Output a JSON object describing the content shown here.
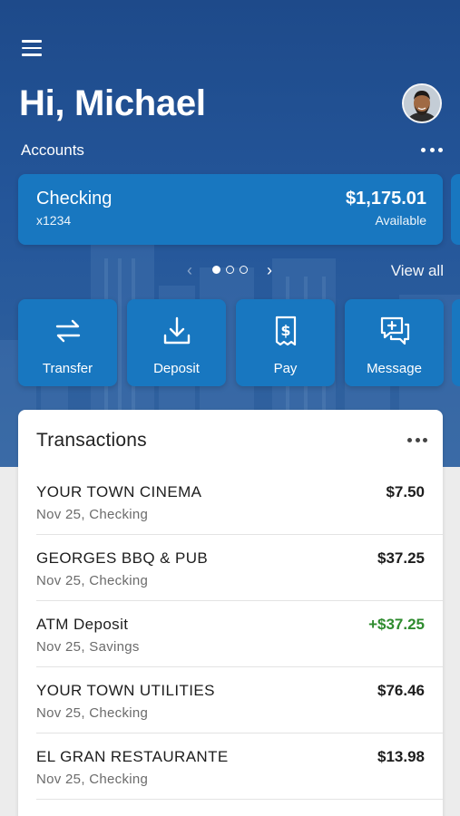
{
  "header": {
    "greeting": "Hi, Michael",
    "menu_icon": "hamburger-menu-icon",
    "avatar_icon": "user-avatar"
  },
  "accounts": {
    "label": "Accounts",
    "more_icon": "more-horizontal-icon",
    "card": {
      "name": "Checking",
      "number": "x1234",
      "balance": "$1,175.01",
      "balance_label": "Available"
    },
    "pager": {
      "total_pages": 3,
      "current_page": 1
    },
    "view_all": "View all"
  },
  "actions": [
    {
      "label": "Transfer",
      "icon": "transfer-arrows-icon"
    },
    {
      "label": "Deposit",
      "icon": "deposit-download-icon"
    },
    {
      "label": "Pay",
      "icon": "pay-bill-icon"
    },
    {
      "label": "Message",
      "icon": "message-add-icon"
    }
  ],
  "transactions": {
    "title": "Transactions",
    "more_icon": "more-horizontal-icon",
    "items": [
      {
        "merchant": "YOUR TOWN CINEMA",
        "meta": "Nov 25, Checking",
        "amount": "$7.50",
        "credit": false
      },
      {
        "merchant": "GEORGES BBQ & PUB",
        "meta": "Nov 25, Checking",
        "amount": "$37.25",
        "credit": false
      },
      {
        "merchant": "ATM Deposit",
        "meta": "Nov 25, Savings",
        "amount": "+$37.25",
        "credit": true
      },
      {
        "merchant": "YOUR TOWN UTILITIES",
        "meta": "Nov 25, Checking",
        "amount": "$76.46",
        "credit": false
      },
      {
        "merchant": "EL GRAN RESTAURANTE",
        "meta": "Nov 25, Checking",
        "amount": "$13.98",
        "credit": false
      }
    ]
  },
  "colors": {
    "hero_background": "#24569a",
    "card_blue": "#1877c0",
    "credit_green": "#2e8b2e"
  }
}
